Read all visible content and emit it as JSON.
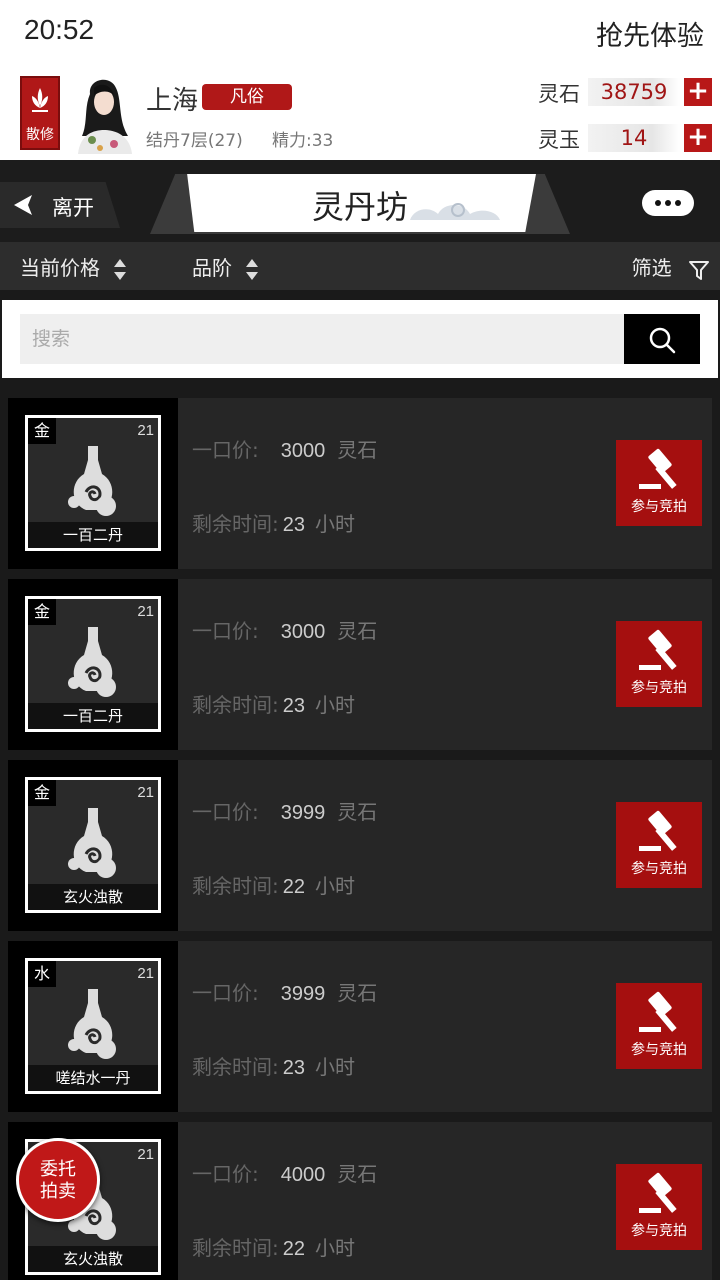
{
  "status": {
    "time": "20:52",
    "beta_label": "抢先体验"
  },
  "profile": {
    "rank_badge": "散修",
    "name": "上海",
    "tag": "凡俗",
    "level": "结丹7层(27)",
    "energy": "精力:33",
    "spirit_stone": {
      "label": "灵石",
      "value": "38759",
      "plus": "+"
    },
    "spirit_jade": {
      "label": "灵玉",
      "value": "14",
      "plus": "+"
    }
  },
  "titlebar": {
    "leave_label": "离开",
    "title": "灵丹坊"
  },
  "sort": {
    "price_label": "当前价格",
    "grade_label": "品阶",
    "filter_label": "筛选"
  },
  "search": {
    "placeholder": "搜索"
  },
  "listings": [
    {
      "element": "金",
      "level": "21",
      "name": "一百二丹",
      "price_label": "一口价:",
      "price": "3000",
      "price_unit": "灵石",
      "time_label": "剩余时间:",
      "time": "23",
      "time_unit": "小时",
      "bid_label": "参与竞拍"
    },
    {
      "element": "金",
      "level": "21",
      "name": "一百二丹",
      "price_label": "一口价:",
      "price": "3000",
      "price_unit": "灵石",
      "time_label": "剩余时间:",
      "time": "23",
      "time_unit": "小时",
      "bid_label": "参与竞拍"
    },
    {
      "element": "金",
      "level": "21",
      "name": "玄火浊散",
      "price_label": "一口价:",
      "price": "3999",
      "price_unit": "灵石",
      "time_label": "剩余时间:",
      "time": "22",
      "time_unit": "小时",
      "bid_label": "参与竞拍"
    },
    {
      "element": "水",
      "level": "21",
      "name": "嗟结水一丹",
      "price_label": "一口价:",
      "price": "3999",
      "price_unit": "灵石",
      "time_label": "剩余时间:",
      "time": "23",
      "time_unit": "小时",
      "bid_label": "参与竞拍"
    },
    {
      "element": "",
      "level": "21",
      "name": "玄火浊散",
      "price_label": "一口价:",
      "price": "4000",
      "price_unit": "灵石",
      "time_label": "剩余时间:",
      "time": "22",
      "time_unit": "小时",
      "bid_label": "参与竞拍"
    }
  ],
  "consign": {
    "line1": "委托",
    "line2": "拍卖"
  },
  "colors": {
    "accent": "#a50f0f",
    "background": "#1a1a1a",
    "card": "#262626"
  }
}
